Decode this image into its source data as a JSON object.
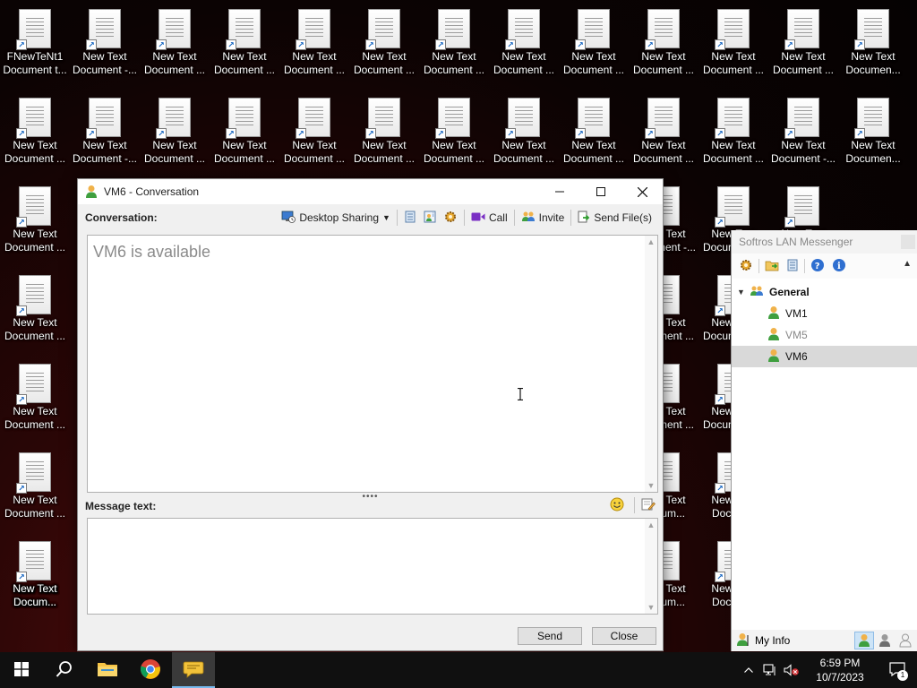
{
  "desktop": {
    "icons": [
      {
        "label": "FNewTeNt1 \nDocument t..."
      },
      {
        "label": "New Text Document -..."
      },
      {
        "label": "New Text Document ..."
      },
      {
        "label": "New Text Document ..."
      },
      {
        "label": "New Text Document ..."
      },
      {
        "label": "New Text Document ..."
      },
      {
        "label": "New Text Document ..."
      },
      {
        "label": "New Text Document ..."
      },
      {
        "label": "New Text Document ..."
      },
      {
        "label": "New Text Document ..."
      },
      {
        "label": "New Text Document ..."
      },
      {
        "label": "New Text Document ..."
      },
      {
        "label": "New Text Documen..."
      },
      {
        "label": "New Text Document ..."
      },
      {
        "label": "New Text Document -..."
      },
      {
        "label": "New Text Document ..."
      },
      {
        "label": "New Text Document ..."
      },
      {
        "label": "New Text Document ..."
      },
      {
        "label": "New Text Document ..."
      },
      {
        "label": "New Text Document ..."
      },
      {
        "label": "New Text Document ..."
      },
      {
        "label": "New Text Document ..."
      },
      {
        "label": "New Text Document ..."
      },
      {
        "label": "New Text Document ..."
      },
      {
        "label": "New Text Document -..."
      },
      {
        "label": "New Text Documen..."
      },
      {
        "label": "New Text Document ..."
      },
      {
        "label": "New Text Document -..."
      },
      {
        "label": "New Text Document ..."
      },
      {
        "label": "New Text Document ..."
      },
      {
        "label": "New Text Document ..."
      },
      {
        "label": "New Text Document ..."
      },
      {
        "label": "New Text Document ..."
      },
      {
        "label": "New Text Document ..."
      },
      {
        "label": "New Text Document ..."
      },
      {
        "label": "New Text Document ..."
      },
      {
        "label": "New Text Document ..."
      },
      {
        "label": "New Text Docum..."
      },
      {
        "label": "New Text Docum..."
      },
      {
        "label": "New Text Docum..."
      },
      {
        "label": "New Text Docum..."
      },
      {
        "label": "New Text Docum..."
      },
      {
        "label": "New Text Docum..."
      },
      {
        "label": "New Text Docum..."
      },
      {
        "label": "New Text Docum..."
      },
      {
        "label": "New Text Docum..."
      }
    ]
  },
  "conversation": {
    "title": "VM6 - Conversation",
    "controls": {
      "minimize": "—",
      "maximize": "☐",
      "close": "✕"
    },
    "label": "Conversation:",
    "toolbar": {
      "desktop_sharing": "Desktop Sharing",
      "call": "Call",
      "invite": "Invite",
      "send_files": "Send File(s)"
    },
    "status_text": "VM6 is available",
    "message_label": "Message text:",
    "send": "Send",
    "close": "Close"
  },
  "lan": {
    "title": "Softros LAN Messenger",
    "group": "General",
    "users": [
      {
        "name": "VM1",
        "state": "online"
      },
      {
        "name": "VM5",
        "state": "offline"
      },
      {
        "name": "VM6",
        "state": "selected"
      }
    ],
    "my_info": "My Info"
  },
  "taskbar": {
    "time": "6:59 PM",
    "date": "10/7/2023",
    "notification_count": "1"
  },
  "colors": {
    "accent": "#76b9ed",
    "online_user": "#f0b24a",
    "user_shirt": "#3f9f3f"
  }
}
